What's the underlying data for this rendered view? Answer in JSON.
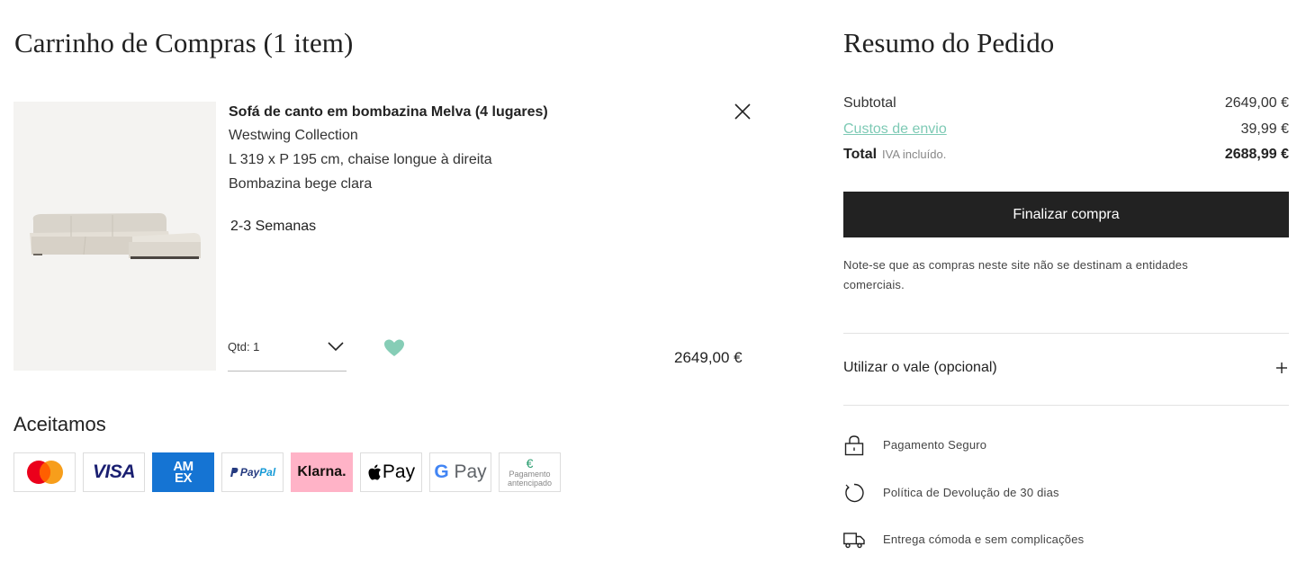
{
  "cart": {
    "title": "Carrinho de Compras (1 item)",
    "item": {
      "name": "Sofá de canto em bombazina Melva (4 lugares)",
      "brand": "Westwing Collection",
      "dimensions": "L 319 x P 195 cm, chaise longue à direita",
      "fabric": "Bombazina bege clara",
      "delivery": "2-3 Semanas",
      "quantity_label": "Qtd: 1",
      "price": "2649,00 €",
      "remove_icon": "close-icon",
      "wishlist_icon": "heart-icon"
    },
    "accept_title": "Aceitamos",
    "payments": {
      "visa": "VISA",
      "amex_top": "AM",
      "amex_bottom": "EX",
      "paypal_a": "Pay",
      "paypal_b": "Pal",
      "klarna": "Klarna.",
      "applepay": "Pay",
      "gpay_g": "G",
      "gpay_pay": "Pay",
      "prepay_euro": "€",
      "prepay_text": "Pagamento antencipado"
    }
  },
  "summary": {
    "title": "Resumo do Pedido",
    "subtotal_label": "Subtotal",
    "subtotal_value": "2649,00 €",
    "shipping_label": "Custos de envio",
    "shipping_value": "39,99 €",
    "total_label": "Total",
    "vat_note": "IVA incluído.",
    "total_value": "2688,99 €",
    "checkout_label": "Finalizar compra",
    "note": "Note-se que as compras neste site não se destinam a entidades comerciais.",
    "voucher_label": "Utilizar o vale (opcional)",
    "features": [
      {
        "icon": "lock-icon",
        "text": "Pagamento Seguro"
      },
      {
        "icon": "return-icon",
        "text": "Política de Devolução de 30 dias"
      },
      {
        "icon": "truck-icon",
        "text": "Entrega cómoda e sem complicações"
      }
    ]
  },
  "colors": {
    "accent": "#7ecab5",
    "button_bg": "#222222",
    "image_bg": "#f4f3f1"
  }
}
